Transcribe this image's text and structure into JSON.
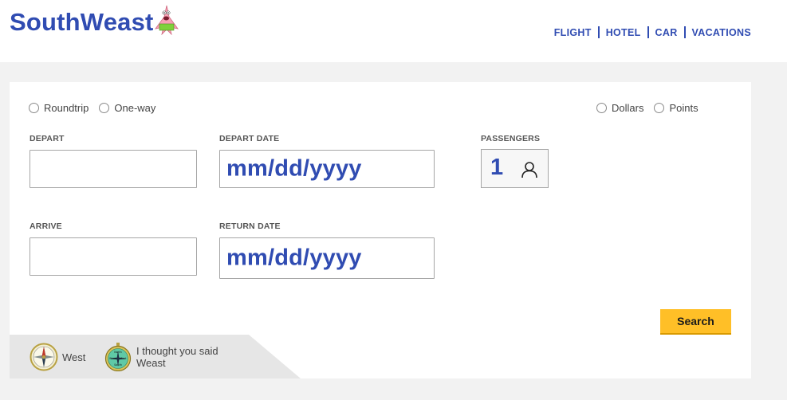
{
  "brand": {
    "name": "SouthWeast",
    "accent": "#304cb2",
    "button": "#ffbf27"
  },
  "nav": [
    {
      "label": "FLIGHT"
    },
    {
      "label": "HOTEL"
    },
    {
      "label": "CAR"
    },
    {
      "label": "VACATIONS"
    }
  ],
  "trip_type": {
    "options": [
      "Roundtrip",
      "One-way"
    ]
  },
  "currency": {
    "options": [
      "Dollars",
      "Points"
    ]
  },
  "form": {
    "depart_label": "DEPART",
    "depart_value": "",
    "arrive_label": "ARRIVE",
    "arrive_value": "",
    "depart_date_label": "DEPART DATE",
    "depart_date_value": "mm/dd/yyyy",
    "return_date_label": "RETURN DATE",
    "return_date_value": "mm/dd/yyyy",
    "passengers_label": "PASSENGERS",
    "passengers_value": "1"
  },
  "search_button": "Search",
  "footer": {
    "west_label": "West",
    "weast_label_line1": "I thought you said",
    "weast_label_line2": "Weast",
    "compass_text": {
      "north": "North",
      "west": "West",
      "east": "East",
      "south": "South"
    }
  },
  "icons": {
    "logo_mascot": "starfish-mascot-icon",
    "passenger": "person-icon",
    "compass_west": "compass-icon",
    "compass_weast": "weast-compass-icon"
  }
}
